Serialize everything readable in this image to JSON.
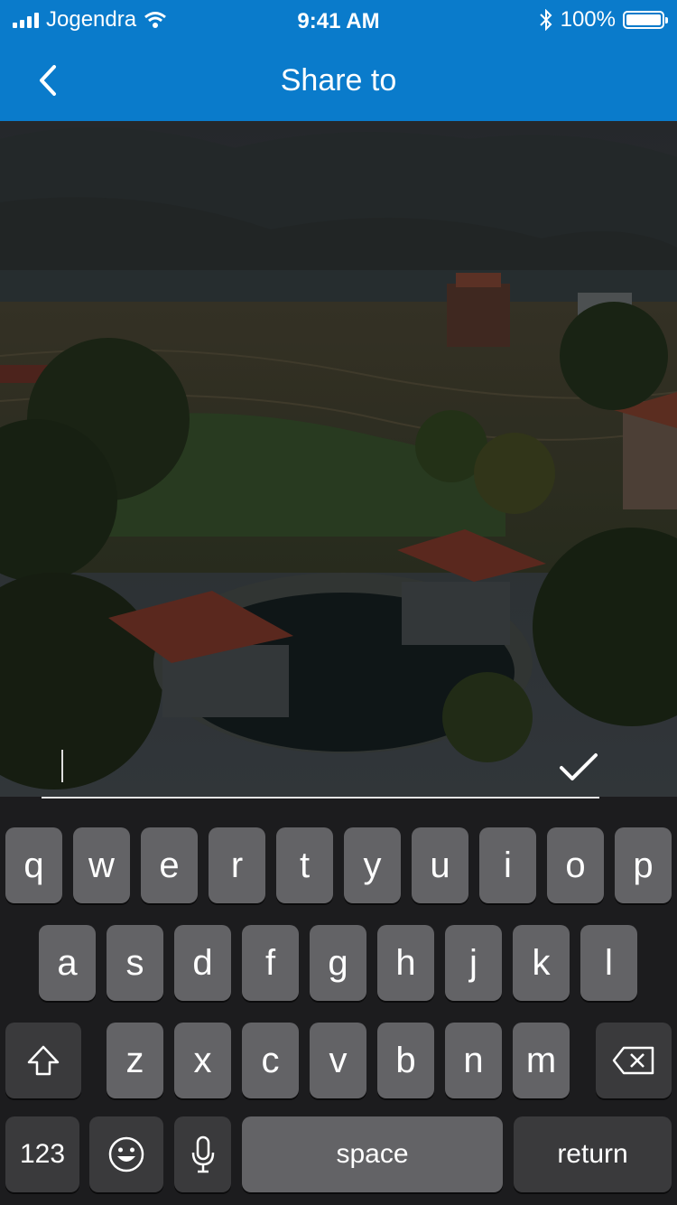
{
  "status_bar": {
    "carrier": "Jogendra",
    "time": "9:41 AM",
    "battery_percent": "100%",
    "battery_level": 1.0,
    "icons": [
      "signal-bars-icon",
      "wifi-icon",
      "bluetooth-icon",
      "battery-icon"
    ]
  },
  "nav": {
    "title": "Share to",
    "back_icon": "chevron-left-icon"
  },
  "caption": {
    "value": "",
    "placeholder": "",
    "confirm_icon": "checkmark-icon"
  },
  "keyboard": {
    "row1": [
      "q",
      "w",
      "e",
      "r",
      "t",
      "y",
      "u",
      "i",
      "o",
      "p"
    ],
    "row2": [
      "a",
      "s",
      "d",
      "f",
      "g",
      "h",
      "j",
      "k",
      "l"
    ],
    "row3": [
      "z",
      "x",
      "c",
      "v",
      "b",
      "n",
      "m"
    ],
    "numbers_label": "123",
    "space_label": "space",
    "return_label": "return",
    "icons": [
      "shift-icon",
      "delete-icon",
      "emoji-icon",
      "microphone-icon"
    ]
  },
  "colors": {
    "accent": "#0a7bcb",
    "key": "#636366",
    "key_dark": "#3a3a3c",
    "keyboard_bg": "#1c1c1e"
  }
}
